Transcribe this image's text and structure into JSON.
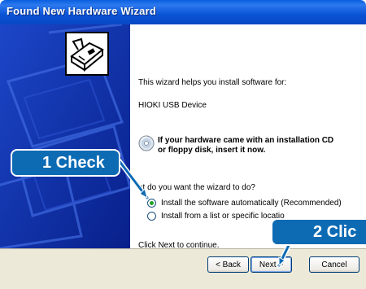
{
  "window": {
    "title": "Found New Hardware Wizard"
  },
  "content": {
    "intro": "This wizard helps you install software for:",
    "device_name": "HIOKI USB Device",
    "cd_hint_line1": "If your hardware came with an installation CD",
    "cd_hint_line2": "or floppy disk, insert it now.",
    "question": "at do you want the wizard to do?",
    "option_auto": "Install the software automatically (Recommended)",
    "option_manual": "Install from a list or specific locatio",
    "continue_text": "Click Next to continue."
  },
  "buttons": {
    "back": "< Back",
    "next": "Next >",
    "cancel": "Cancel"
  },
  "callouts": {
    "step1": "1 Check",
    "step2": "2 Clic"
  },
  "colors": {
    "title_bar": "#0a5fe0",
    "side_panel": "#0a2a9e",
    "callout": "#0d6bb4",
    "radio_selected": "#21a121"
  },
  "icons": [
    "hardware-card-icon",
    "cd-icon"
  ]
}
